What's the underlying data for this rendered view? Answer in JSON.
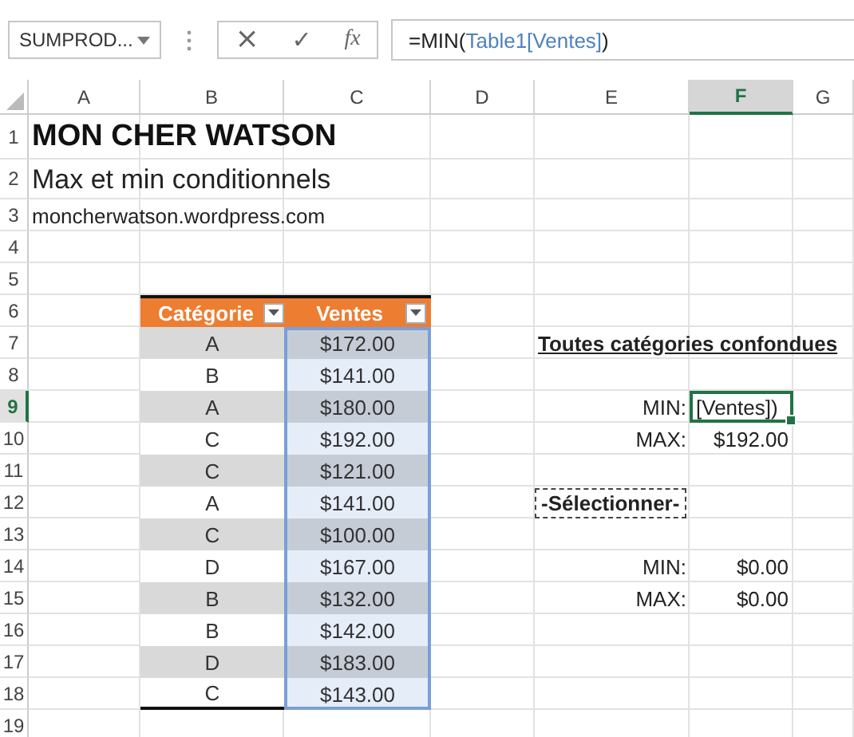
{
  "name_box": {
    "value": "SUMPROD..."
  },
  "formula_bar": {
    "cancel": "×",
    "enter": "✓",
    "function": "fx",
    "formula": [
      {
        "text": "=MIN(",
        "kind": "plain"
      },
      {
        "text": "Table1[Ventes]",
        "kind": "ref"
      },
      {
        "text": ")",
        "kind": "plain"
      }
    ]
  },
  "columns": [
    {
      "label": "A",
      "selected": false
    },
    {
      "label": "B",
      "selected": false
    },
    {
      "label": "C",
      "selected": false
    },
    {
      "label": "D",
      "selected": false
    },
    {
      "label": "E",
      "selected": false
    },
    {
      "label": "F",
      "selected": true
    },
    {
      "label": "G",
      "selected": false
    }
  ],
  "rows": [
    {
      "label": "1",
      "selected": false
    },
    {
      "label": "2",
      "selected": false
    },
    {
      "label": "3",
      "selected": false
    },
    {
      "label": "4",
      "selected": false
    },
    {
      "label": "5",
      "selected": false
    },
    {
      "label": "6",
      "selected": false
    },
    {
      "label": "7",
      "selected": false
    },
    {
      "label": "8",
      "selected": false
    },
    {
      "label": "9",
      "selected": true
    },
    {
      "label": "10",
      "selected": false
    },
    {
      "label": "11",
      "selected": false
    },
    {
      "label": "12",
      "selected": false
    },
    {
      "label": "13",
      "selected": false
    },
    {
      "label": "14",
      "selected": false
    },
    {
      "label": "15",
      "selected": false
    },
    {
      "label": "16",
      "selected": false
    },
    {
      "label": "17",
      "selected": false
    },
    {
      "label": "18",
      "selected": false
    },
    {
      "label": "19",
      "selected": false
    }
  ],
  "title": "MON CHER WATSON",
  "subtitle": "Max et min conditionnels",
  "url": "moncherwatson.wordpress.com",
  "table": {
    "headers": [
      "Catégorie",
      "Ventes"
    ],
    "rows": [
      {
        "category": "A",
        "sales": "$172.00"
      },
      {
        "category": "B",
        "sales": "$141.00"
      },
      {
        "category": "A",
        "sales": "$180.00"
      },
      {
        "category": "C",
        "sales": "$192.00"
      },
      {
        "category": "C",
        "sales": "$121.00"
      },
      {
        "category": "A",
        "sales": "$141.00"
      },
      {
        "category": "C",
        "sales": "$100.00"
      },
      {
        "category": "D",
        "sales": "$167.00"
      },
      {
        "category": "B",
        "sales": "$132.00"
      },
      {
        "category": "B",
        "sales": "$142.00"
      },
      {
        "category": "D",
        "sales": "$183.00"
      },
      {
        "category": "C",
        "sales": "$143.00"
      }
    ]
  },
  "overall": {
    "heading": "Toutes catégories confondues",
    "min_label": "MIN:",
    "min_value": "[Ventes])",
    "min_active": true,
    "max_label": "MAX:",
    "max_value": "$192.00"
  },
  "by_category": {
    "selector": "-Sélectionner-",
    "min_label": "MIN:",
    "min_value": "$0.00",
    "max_label": "MAX:",
    "max_value": "$0.00"
  }
}
